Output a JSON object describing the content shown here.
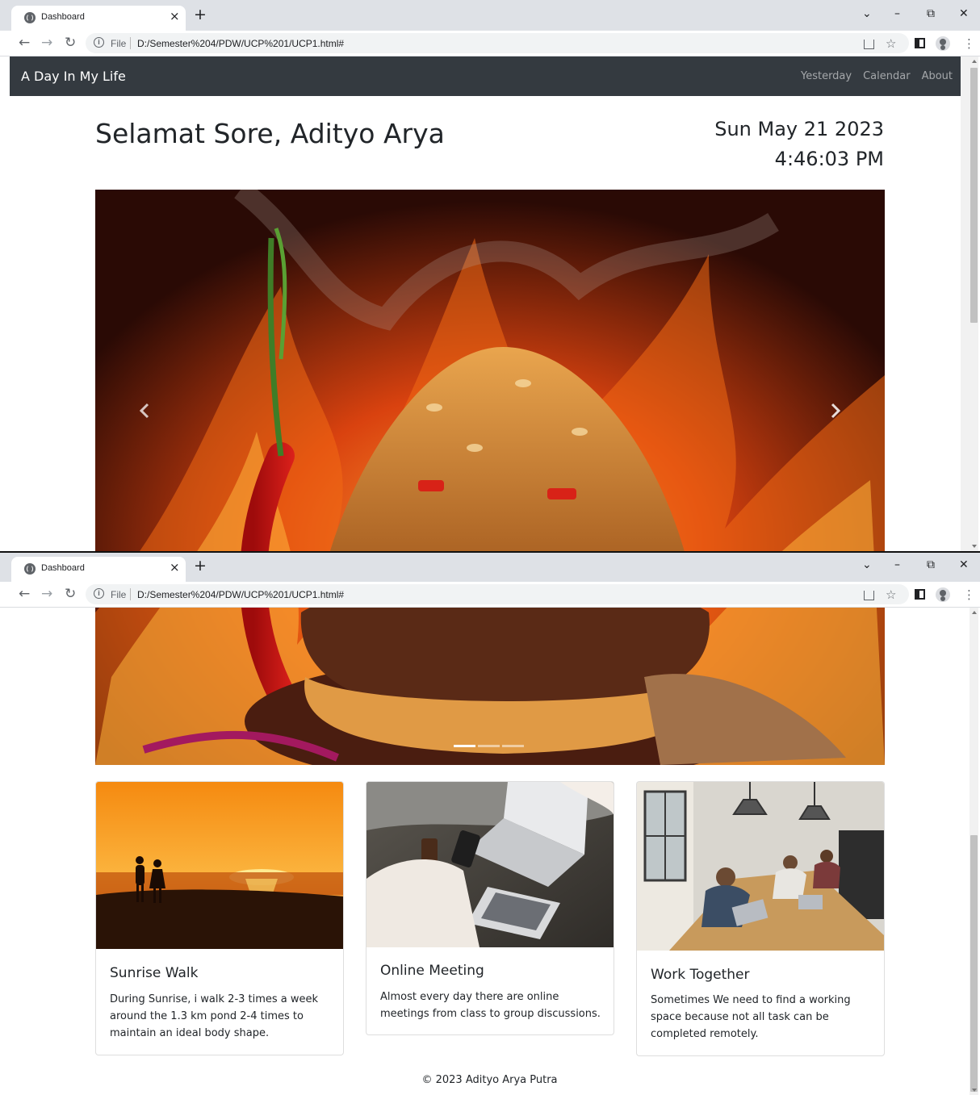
{
  "browser": {
    "tab_title": "Dashboard",
    "new_tab": "+",
    "close_tab": "×",
    "address_prefix": "File",
    "address_url": "D:/Semester%204/PDW/UCP%201/UCP1.html#",
    "controls": {
      "chevron": "⌄",
      "minimize": "–",
      "restore": "⧉",
      "close": "✕"
    },
    "nav": {
      "back": "←",
      "forward": "→",
      "reload": "↻",
      "info": "i",
      "star": "☆",
      "menu": "⋮"
    }
  },
  "navbar": {
    "brand": "A Day In My Life",
    "links": [
      "Yesterday",
      "Calendar",
      "About"
    ]
  },
  "header": {
    "greeting": "Selamat Sore, Adityo Arya",
    "date": "Sun May 21 2023",
    "time": "4:46:03 PM"
  },
  "carousel": {
    "slide_count": 3,
    "active_index": 0
  },
  "cards": [
    {
      "title": "Sunrise Walk",
      "text": "During Sunrise, i walk 2-3 times a week around the 1.3 km pond 2-4 times to maintain an ideal body shape."
    },
    {
      "title": "Online Meeting",
      "text": "Almost every day there are online meetings from class to group discussions."
    },
    {
      "title": "Work Together",
      "text": "Sometimes We need to find a working space because not all task can be completed remotely."
    }
  ],
  "footer": {
    "text": "© 2023 Adityo Arya Putra"
  },
  "colors": {
    "navbar": "#343a40",
    "chrome_tabbar": "#dee1e6",
    "omnibox": "#f1f3f4"
  }
}
